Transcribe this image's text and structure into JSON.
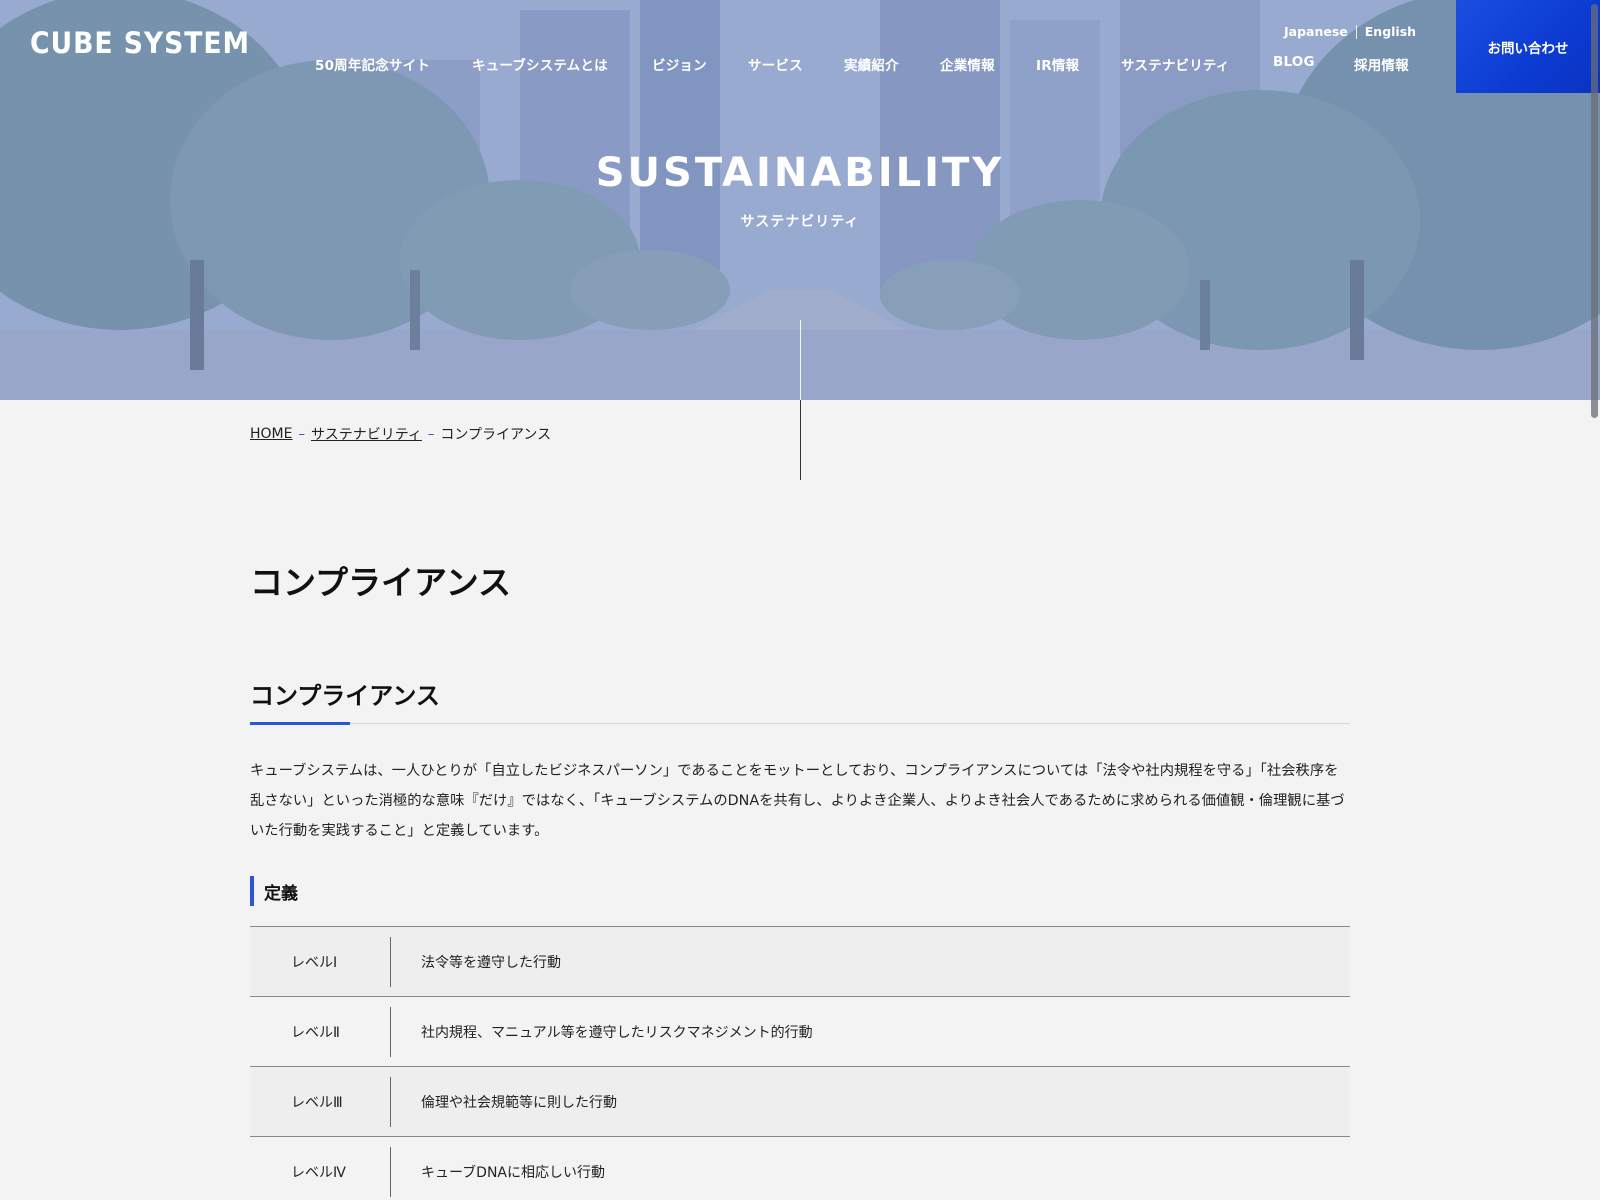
{
  "header": {
    "logo": "CUBE SYSTEM",
    "languages": [
      "Japanese",
      "English"
    ],
    "nav": [
      "50周年記念サイト",
      "キューブシステムとは",
      "ビジョン",
      "サービス",
      "実績紹介",
      "企業情報",
      "IR情報",
      "サステナビリティ",
      "BLOG",
      "採用情報"
    ],
    "contact_label": "お問い合わせ"
  },
  "hero": {
    "title": "SUSTAINABILITY",
    "subtitle": "サステナビリティ"
  },
  "breadcrumb": {
    "home": "HOME",
    "parent": "サステナビリティ",
    "current": "コンプライアンス",
    "separator": "–"
  },
  "main": {
    "page_title": "コンプライアンス",
    "section_title": "コンプライアンス",
    "body": "キューブシステムは、一人ひとりが「自立したビジネスパーソン」であることをモットーとしており、コンプライアンスについては「法令や社内規程を守る」「社会秩序を乱さない」といった消極的な意味『だけ』ではなく、「キューブシステムのDNAを共有し、よりよき企業人、よりよき社会人であるために求められる価値観・倫理観に基づいた行動を実践すること」と定義しています。",
    "definition_title": "定義",
    "definitions": [
      {
        "level": "レベルⅠ",
        "desc": "法令等を遵守した行動"
      },
      {
        "level": "レベルⅡ",
        "desc": "社内規程、マニュアル等を遵守したリスクマネジメント的行動"
      },
      {
        "level": "レベルⅢ",
        "desc": "倫理や社会規範等に則した行動"
      },
      {
        "level": "レベルⅣ",
        "desc": "キューブDNAに相応しい行動"
      }
    ]
  },
  "colors": {
    "accent": "#2b57d6",
    "contact_bg": "#0f3fd6",
    "page_bg": "#f4f3f4"
  }
}
